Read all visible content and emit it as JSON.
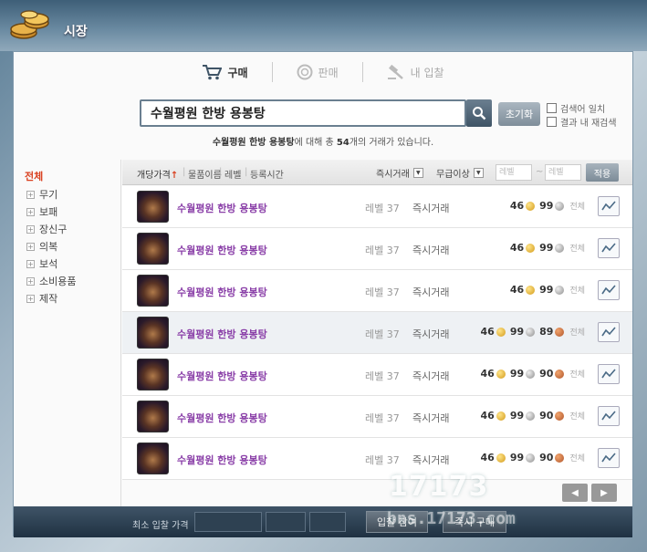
{
  "window": {
    "title": "시장"
  },
  "tabs": [
    {
      "label": "구매",
      "icon": "cart-icon",
      "active": true
    },
    {
      "label": "판매",
      "icon": "coin-icon",
      "active": false
    },
    {
      "label": "내 입찰",
      "icon": "gavel-icon",
      "active": false
    }
  ],
  "search": {
    "value": "수월평원 한방 용봉탕",
    "reset_label": "초기화",
    "option_exact": "검색어 일치",
    "option_within": "결과 내 재검색",
    "result_prefix": "수월평원 한방 용봉탕",
    "result_mid": "에 대해 총 ",
    "result_count": "54",
    "result_suffix": "개의 거래가 있습니다."
  },
  "sidebar": {
    "all_label": "전체",
    "items": [
      {
        "label": "무기"
      },
      {
        "label": "보패"
      },
      {
        "label": "장신구"
      },
      {
        "label": "의복"
      },
      {
        "label": "보석"
      },
      {
        "label": "소비용품"
      },
      {
        "label": "제작"
      }
    ]
  },
  "filters": {
    "sort_price": "개당가격",
    "sort_arrow": "↑",
    "sort_name": "물품이름",
    "sort_level": "레벨",
    "sort_time": "등록시간",
    "mode_dropdown": "즉시거래",
    "grade_dropdown": "무급이상",
    "level_min_placeholder": "레벨",
    "level_max_placeholder": "레벨",
    "tilde": "~",
    "apply_label": "적용"
  },
  "rows": [
    {
      "name": "수월평원 한방 용봉탕",
      "level": "레벨 37",
      "mode": "즉시거래",
      "gold": "46",
      "silver": "99",
      "copper": "",
      "unit": "전체"
    },
    {
      "name": "수월평원 한방 용봉탕",
      "level": "레벨 37",
      "mode": "즉시거래",
      "gold": "46",
      "silver": "99",
      "copper": "",
      "unit": "전체"
    },
    {
      "name": "수월평원 한방 용봉탕",
      "level": "레벨 37",
      "mode": "즉시거래",
      "gold": "46",
      "silver": "99",
      "copper": "",
      "unit": "전체"
    },
    {
      "name": "수월평원 한방 용봉탕",
      "level": "레벨 37",
      "mode": "즉시거래",
      "gold": "46",
      "silver": "99",
      "copper": "89",
      "unit": "전체"
    },
    {
      "name": "수월평원 한방 용봉탕",
      "level": "레벨 37",
      "mode": "즉시거래",
      "gold": "46",
      "silver": "99",
      "copper": "90",
      "unit": "전체"
    },
    {
      "name": "수월평원 한방 용봉탕",
      "level": "레벨 37",
      "mode": "즉시거래",
      "gold": "46",
      "silver": "99",
      "copper": "90",
      "unit": "전체"
    },
    {
      "name": "수월평원 한방 용봉탕",
      "level": "레벨 37",
      "mode": "즉시거래",
      "gold": "46",
      "silver": "99",
      "copper": "90",
      "unit": "전체"
    }
  ],
  "bottom": {
    "min_bid_label": "최소 입찰 가격",
    "bid_button": "입찰 참여",
    "buy_button": "즉시 구매"
  },
  "watermark": {
    "big": "17173",
    "small": "bns.17173.com"
  },
  "colors": {
    "accent_red": "#d9401f",
    "item_name": "#8a3fa8",
    "bottom_bar": "#1f3142"
  }
}
